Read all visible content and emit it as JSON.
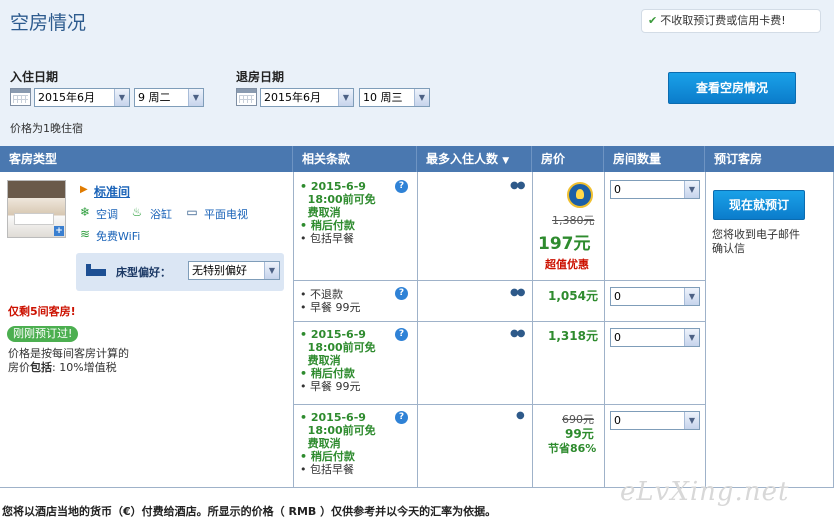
{
  "header": {
    "title": "空房情况",
    "no_fee_text": "不收取预订费或信用卡费!"
  },
  "search": {
    "checkin_label": "入住日期",
    "checkin_month": "2015年6月",
    "checkin_day": "9 周二",
    "checkout_label": "退房日期",
    "checkout_month": "2015年6月",
    "checkout_day": "10 周三",
    "price_note": "价格为1晚住宿",
    "check_button": "查看空房情况"
  },
  "table": {
    "headers": [
      "客房类型",
      "相关条款",
      "最多入住人数",
      "房价",
      "房间数量",
      "预订客房"
    ]
  },
  "room": {
    "name": "标准间",
    "amenities": [
      "空调",
      "浴缸",
      "平面电视",
      "免费WiFi"
    ],
    "bed_pref_label": "床型偏好：",
    "bed_pref_value": "无特别偏好",
    "last_rooms": "仅剩5间客房!",
    "just_booked": "刚刚预订过!",
    "price_note_line1": "价格是按每间客房计算的",
    "price_note_line2_prefix": "房价",
    "price_note_line2_bold": "包括",
    "price_note_line2_suffix": ": 10%增值税"
  },
  "rates": [
    {
      "cond_date": "2015-6-9",
      "cond_cancel1": "18:00前可免",
      "cond_cancel2": "费取消",
      "cond_pay": "稍后付款",
      "cond_meal": "包括早餐",
      "old_price": "1,380元",
      "price": "197元",
      "deal_label": "超值优惠",
      "qty": "0"
    },
    {
      "cond_line1": "不退款",
      "cond_meal": "早餐 99元",
      "price": "1,054元",
      "qty": "0"
    },
    {
      "cond_date": "2015-6-9",
      "cond_cancel1": "18:00前可免",
      "cond_cancel2": "费取消",
      "cond_pay": "稍后付款",
      "cond_meal": "早餐 99元",
      "price": "1,318元",
      "qty": "0"
    },
    {
      "cond_date": "2015-6-9",
      "cond_cancel1": "18:00前可免",
      "cond_cancel2": "费取消",
      "cond_pay": "稍后付款",
      "cond_meal": "包括早餐",
      "old_price": "690元",
      "price": "99元",
      "deal_label": "节省86%",
      "qty": "0"
    }
  ],
  "booking": {
    "book_button": "现在就预订",
    "confirm_line1": "您将收到电子邮件",
    "confirm_line2": "确认信"
  },
  "footer": {
    "text": "您将以酒店当地的货币（€）付费给酒店。所显示的价格（ RMB ）仅供参考并以今天的汇率为依据。"
  },
  "watermark": "eLvXing.net",
  "colors": {
    "header_bg": "#4a78b0",
    "button_blue": "#0b7ccb",
    "price_green": "#2e8b2e",
    "alert_red": "#cc1100",
    "top_bg": "#eaf1f9"
  }
}
